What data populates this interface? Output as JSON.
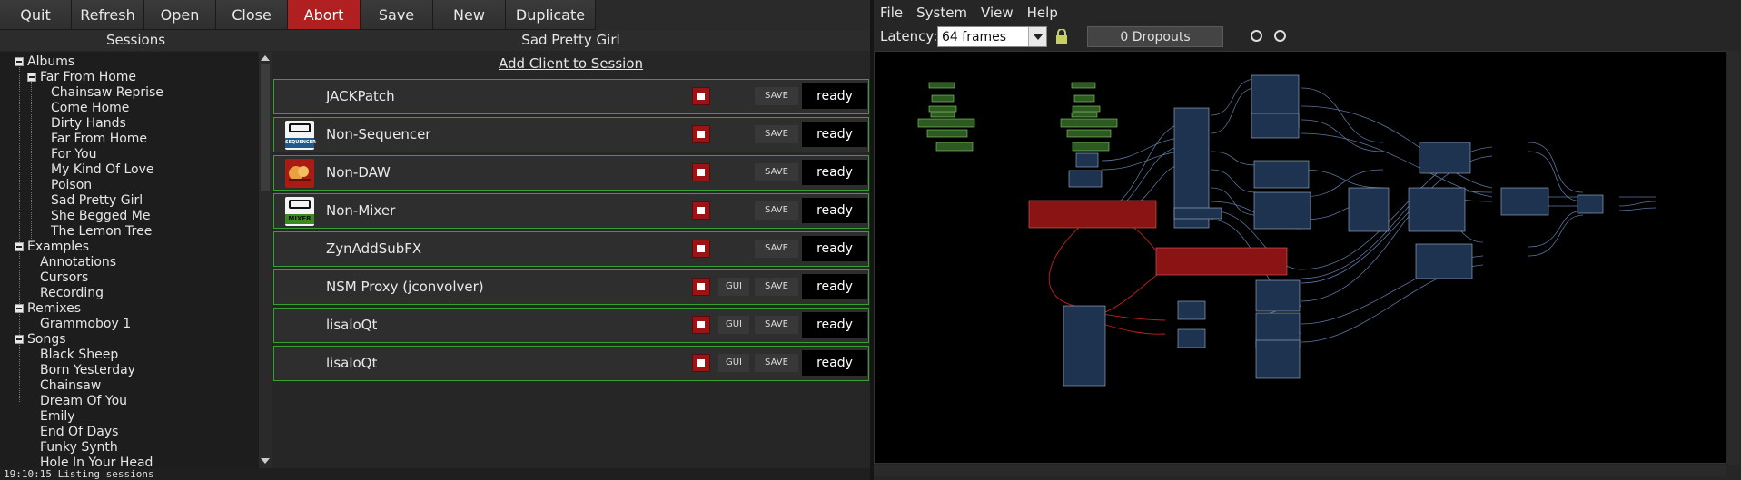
{
  "toolbar": {
    "buttons": [
      {
        "label": "Quit"
      },
      {
        "label": "Refresh"
      },
      {
        "label": "Open"
      },
      {
        "label": "Close"
      },
      {
        "label": "Abort"
      },
      {
        "label": "Save"
      },
      {
        "label": "New"
      },
      {
        "label": "Duplicate"
      }
    ]
  },
  "sessions": {
    "header": "Sessions",
    "tree": [
      {
        "label": "Albums"
      },
      {
        "label": "Far From Home"
      },
      {
        "label": "Chainsaw Reprise"
      },
      {
        "label": "Come Home"
      },
      {
        "label": "Dirty Hands"
      },
      {
        "label": "Far From Home"
      },
      {
        "label": "For You"
      },
      {
        "label": "My Kind Of Love"
      },
      {
        "label": "Poison"
      },
      {
        "label": "Sad Pretty Girl"
      },
      {
        "label": "She Begged Me"
      },
      {
        "label": "The Lemon Tree"
      },
      {
        "label": "Examples"
      },
      {
        "label": "Annotations"
      },
      {
        "label": "Cursors"
      },
      {
        "label": "Recording"
      },
      {
        "label": "Remixes"
      },
      {
        "label": "Grammoboy 1"
      },
      {
        "label": "Songs"
      },
      {
        "label": "Black Sheep"
      },
      {
        "label": "Born Yesterday"
      },
      {
        "label": "Chainsaw"
      },
      {
        "label": "Dream Of You"
      },
      {
        "label": "Emily"
      },
      {
        "label": "End Of Days"
      },
      {
        "label": "Funky Synth"
      },
      {
        "label": "Hole In Your Head"
      }
    ]
  },
  "session": {
    "title": "Sad Pretty Girl",
    "add_client": "Add Client to Session",
    "clients": [
      {
        "name": "JACKPatch",
        "icon": "none",
        "save": "SAVE",
        "status": "ready"
      },
      {
        "name": "Non-Sequencer",
        "icon": "non-sequencer-icon",
        "icon_text": "SEQUENCER",
        "save": "SAVE",
        "status": "ready"
      },
      {
        "name": "Non-DAW",
        "icon": "non-daw-icon",
        "save": "SAVE",
        "status": "ready"
      },
      {
        "name": "Non-Mixer",
        "icon": "non-mixer-icon",
        "icon_text": "MIXER",
        "save": "SAVE",
        "status": "ready"
      },
      {
        "name": "ZynAddSubFX",
        "icon": "none",
        "save": "SAVE",
        "status": "ready"
      },
      {
        "name": "NSM Proxy (jconvolver)",
        "icon": "none",
        "gui": "GUI",
        "save": "SAVE",
        "status": "ready"
      },
      {
        "name": "lisaloQt",
        "icon": "none",
        "gui": "GUI",
        "save": "SAVE",
        "status": "ready"
      },
      {
        "name": "lisaloQt",
        "icon": "none",
        "gui": "GUI",
        "save": "SAVE",
        "status": "ready"
      }
    ]
  },
  "statusline": "19:10:15 Listing sessions",
  "patchbay": {
    "menus": [
      {
        "label": "File"
      },
      {
        "label": "System"
      },
      {
        "label": "View"
      },
      {
        "label": "Help"
      }
    ],
    "latency_label": "Latency:",
    "latency_value": "64 frames",
    "dropouts": "0 Dropouts"
  },
  "colors": {
    "abort": "#b02020",
    "client_border": "#36a030",
    "stop": "#9a1414",
    "module_blue": "#1e3350",
    "module_red": "#8a1414",
    "module_green": "#2c5a20"
  }
}
